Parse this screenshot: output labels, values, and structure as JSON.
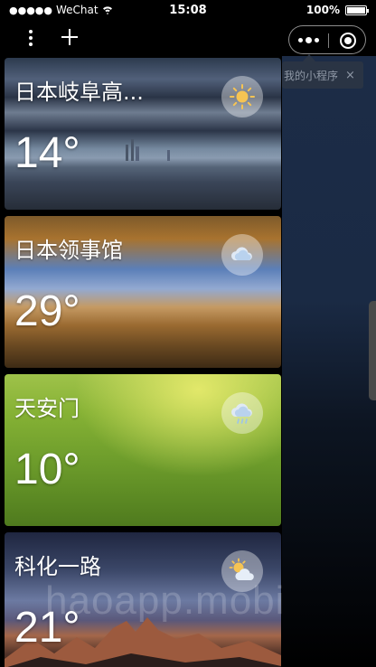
{
  "status_bar": {
    "signal_dots": "●●●●●",
    "carrier": "WeChat",
    "time": "15:08",
    "battery_percent": "100%",
    "battery_level": 1.0
  },
  "nav_bar": {
    "more_icon": "kebab-vertical-icon",
    "add_icon": "plus-icon",
    "capsule_more_icon": "ellipsis-icon",
    "capsule_close_icon": "target-circle-icon"
  },
  "tooltip": {
    "text": "我的小程序",
    "close_symbol": "×"
  },
  "cards": [
    {
      "city": "日本岐阜高...",
      "temperature": "14°",
      "weather_icon": "sunny-icon"
    },
    {
      "city": "日本领事馆",
      "temperature": "29°",
      "weather_icon": "cloudy-icon"
    },
    {
      "city": "天安门",
      "temperature": "10°",
      "weather_icon": "cloud-rain-icon"
    },
    {
      "city": "科化一路",
      "temperature": "21°",
      "weather_icon": "sun-cloud-icon"
    }
  ],
  "watermark": "haoapp.mobi",
  "colors": {
    "background": "#000000",
    "side_panel": "#1c2c47",
    "tooltip_bg": "#2a3444"
  }
}
